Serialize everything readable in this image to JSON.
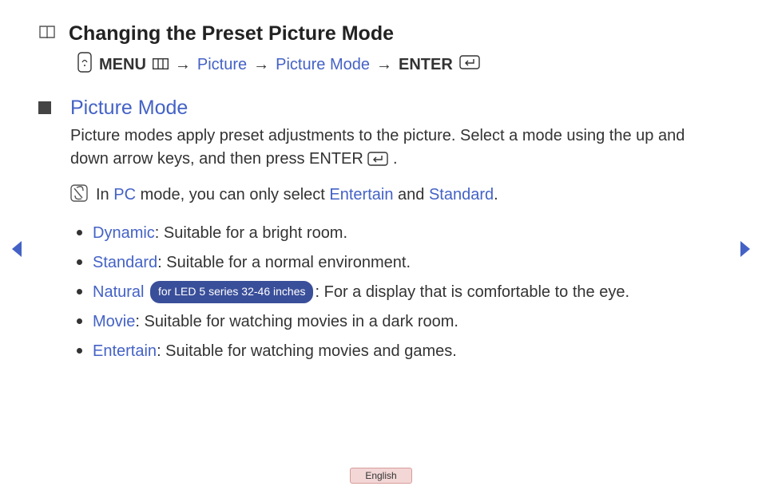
{
  "title": "Changing the Preset Picture Mode",
  "nav": {
    "menu_label": "MENU",
    "picture_label": "Picture",
    "picture_mode_label": "Picture Mode",
    "enter_label": "ENTER"
  },
  "section": {
    "heading": "Picture Mode",
    "desc_pre": "Picture modes apply preset adjustments to the picture. Select a mode using the up and down arrow keys, and then press ",
    "desc_enter": "ENTER",
    "desc_post": ".",
    "note_pre": " In ",
    "note_pc": "PC",
    "note_mid": " mode, you can only select ",
    "note_entertain": "Entertain",
    "note_and": " and ",
    "note_standard": "Standard",
    "note_end": "."
  },
  "modes": [
    {
      "name": "Dynamic",
      "desc": ": Suitable for a bright room."
    },
    {
      "name": "Standard",
      "desc": ": Suitable for a normal environment."
    },
    {
      "name": "Natural",
      "badge": "for LED 5 series 32-46 inches",
      "desc": ": For a display that is comfortable to the eye."
    },
    {
      "name": "Movie",
      "desc": ": Suitable for watching movies in a dark room."
    },
    {
      "name": "Entertain",
      "desc": ": Suitable for watching movies and games."
    }
  ],
  "language": "English"
}
